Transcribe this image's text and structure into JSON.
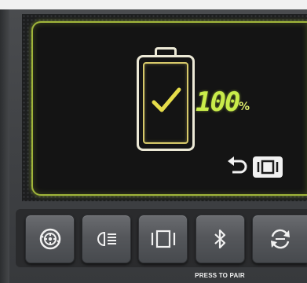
{
  "display": {
    "charge_value": "100",
    "charge_unit": "%",
    "charge_level": 1.0,
    "status_icon": "check-icon",
    "accent_color": "#c9ec4a",
    "frame_glow_color": "#a0b53a",
    "return_icon": "return-icon",
    "screen_mode_icon": "screen-mode-icon"
  },
  "buttons": [
    {
      "id": "tire",
      "icon": "tire-icon"
    },
    {
      "id": "headlight",
      "icon": "headlight-icon"
    },
    {
      "id": "display",
      "icon": "screen-mode-icon"
    },
    {
      "id": "bluetooth",
      "icon": "bluetooth-icon"
    },
    {
      "id": "sync",
      "icon": "sync-icon"
    }
  ],
  "bluetooth_hint": "PRESS TO PAIR"
}
